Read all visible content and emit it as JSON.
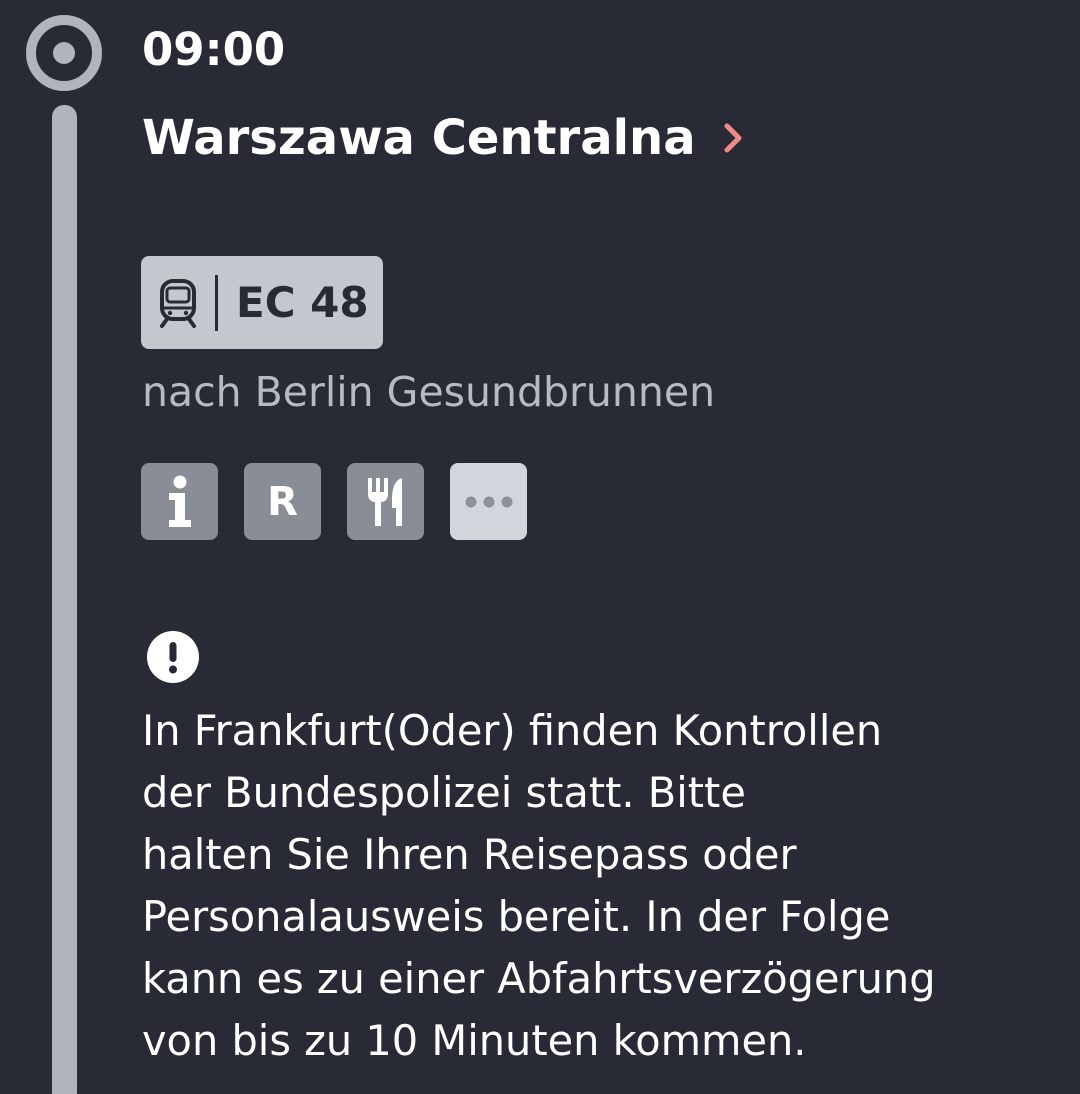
{
  "stop": {
    "time": "09:00",
    "station": "Warszawa Centralna"
  },
  "train": {
    "number": "EC 48",
    "icon": "train-icon",
    "direction": "nach Berlin Gesundbrunnen"
  },
  "amenities": [
    {
      "icon": "info-icon",
      "label": "i"
    },
    {
      "icon": "reservation-icon",
      "label": "R"
    },
    {
      "icon": "dining-icon",
      "label": ""
    },
    {
      "icon": "more-icon",
      "label": ""
    }
  ],
  "notice": {
    "icon": "exclamation-circle-icon",
    "text": "In Frankfurt(Oder) finden Kontrollen\nder Bundespolizei statt. Bitte\nhalten Sie Ihren Reisepass oder\nPersonalausweis bereit. In der Folge\nkann es zu einer Abfahrtsverzögerung\nvon bis zu 10 Minuten kommen."
  },
  "colors": {
    "background": "#282b35",
    "timeline": "#b0b4bc",
    "accent_chevron": "#f08a88",
    "badge": "#c4c7ce",
    "amenity": "#898d96",
    "muted_text": "#b6bac2"
  }
}
